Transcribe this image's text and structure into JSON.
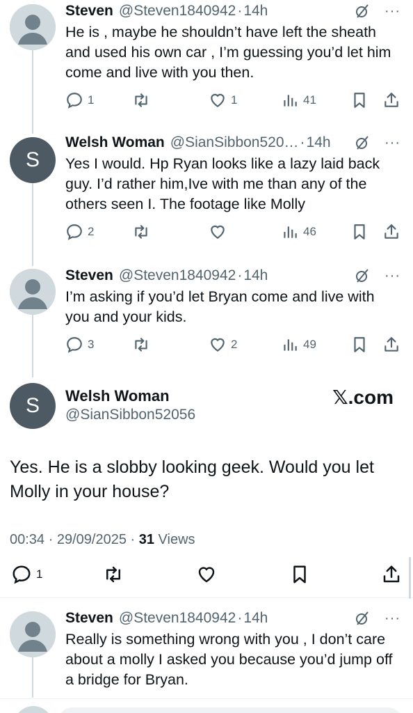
{
  "replies_above": [
    {
      "name": "Steven",
      "handle": "@Steven1840942",
      "dot": "·",
      "time": "14h",
      "text": "He is , maybe he shouldn’t have left the sheath and used his own car , I’m guessing you’d let him come and live with you then.",
      "avatar": "default-avatar-icon",
      "replies": "1",
      "reposts": "",
      "likes": "1",
      "views": "41"
    },
    {
      "name": "Welsh Woman",
      "handle": "@SianSibbon520…",
      "dot": "·",
      "time": "14h",
      "text": "Yes I would. Hp Ryan looks like a lazy laid back guy.  I’d rather him,Ive with me than any of the others seen I. The footage like Molly",
      "avatar_letter": "S",
      "replies": "2",
      "reposts": "",
      "likes": "",
      "views": "46"
    },
    {
      "name": "Steven",
      "handle": "@Steven1840942",
      "dot": "·",
      "time": "14h",
      "text": "I’m asking if you’d let Bryan come and live with you and your kids.",
      "avatar": "default-avatar-icon",
      "replies": "3",
      "reposts": "",
      "likes": "2",
      "views": "49"
    }
  ],
  "main_tweet": {
    "name": "Welsh Woman",
    "handle": "@SianSibbon52056",
    "avatar_letter": "S",
    "brand": "𝕏.com",
    "text": "Yes.   He is a slobby looking geek. Would you let Molly in your house?",
    "time": "00:34",
    "sep1": " · ",
    "date": "29/09/2025",
    "sep2": " · ",
    "views_count": "31",
    "views_label": " Views",
    "replies": "1"
  },
  "reply_below": {
    "name": "Steven",
    "handle": "@Steven1840942",
    "dot": "·",
    "time": "14h",
    "text": "Really is something wrong with you , I don’t care about a molly I asked you because you’d jump off a bridge for Bryan."
  },
  "colors": {
    "text": "#0f1419",
    "secondary": "#536471",
    "line": "#cfd9de",
    "avatar_letter_bg": "#4d5a63"
  }
}
